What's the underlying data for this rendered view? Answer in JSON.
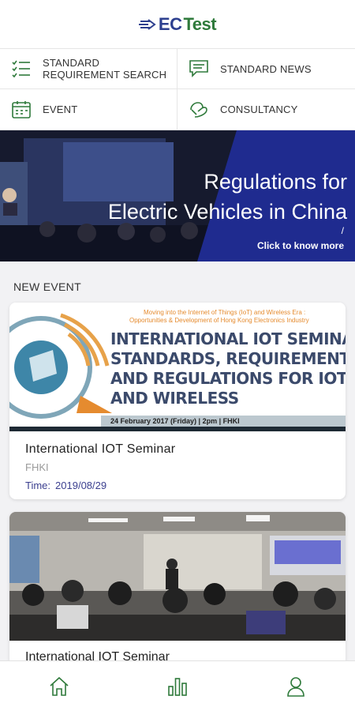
{
  "brand": {
    "ec": "EC",
    "test": "Test"
  },
  "menu": [
    {
      "label": "STANDARD REQUIREMENT SEARCH",
      "icon": "list-icon"
    },
    {
      "label": "STANDARD NEWS",
      "icon": "chat-icon"
    },
    {
      "label": "EVENT",
      "icon": "calendar-icon"
    },
    {
      "label": "CONSULTANCY",
      "icon": "handshake-icon"
    }
  ],
  "banner": {
    "line1": "Regulations for",
    "line2": "Electric Vehicles in China",
    "slash": "/",
    "cta": "Click to know more"
  },
  "new_event": {
    "heading": "NEW EVENT",
    "cards": [
      {
        "poster_kicker": "Moving into the Internet of Things (IoT) and Wireless Era :",
        "poster_kicker2": "Opportunities & Development of Hong Kong Electronics Industry",
        "poster_title1": "INTERNATIONAL IOT SEMINAR",
        "poster_title2": "STANDARDS, REQUIREMENTS",
        "poster_title3": "AND REGULATIONS FOR IOT",
        "poster_title4": "AND WIRELESS",
        "poster_date": "24 February 2017 (Friday)  |  2pm  |  FHKI",
        "title": "International IOT Seminar",
        "org": "FHKI",
        "time_label": "Time:",
        "time_value": "2019/08/29"
      },
      {
        "title": "International IOT Seminar"
      }
    ]
  },
  "colors": {
    "brand_blue": "#2d3f8f",
    "brand_green": "#2f7a3b",
    "accent_navy": "#1f2b8f",
    "time_color": "#3b3f8f"
  },
  "bottom_nav": [
    {
      "icon": "home-icon"
    },
    {
      "icon": "chart-icon"
    },
    {
      "icon": "user-icon"
    }
  ]
}
